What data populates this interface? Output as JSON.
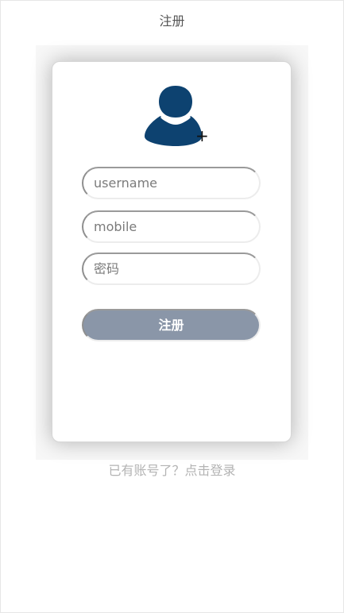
{
  "header": {
    "title": "注册"
  },
  "form": {
    "avatar": {
      "icon": "user-silhouette-icon",
      "color": "#0d4270",
      "add_symbol": "+"
    },
    "username": {
      "value": "",
      "placeholder": "username"
    },
    "mobile": {
      "value": "",
      "placeholder": "mobile"
    },
    "password": {
      "value": "",
      "placeholder": "密码"
    },
    "submit_label": "注册",
    "submit_color": "#8a96a8"
  },
  "footer": {
    "login_link": "已有账号了？点击登录"
  }
}
